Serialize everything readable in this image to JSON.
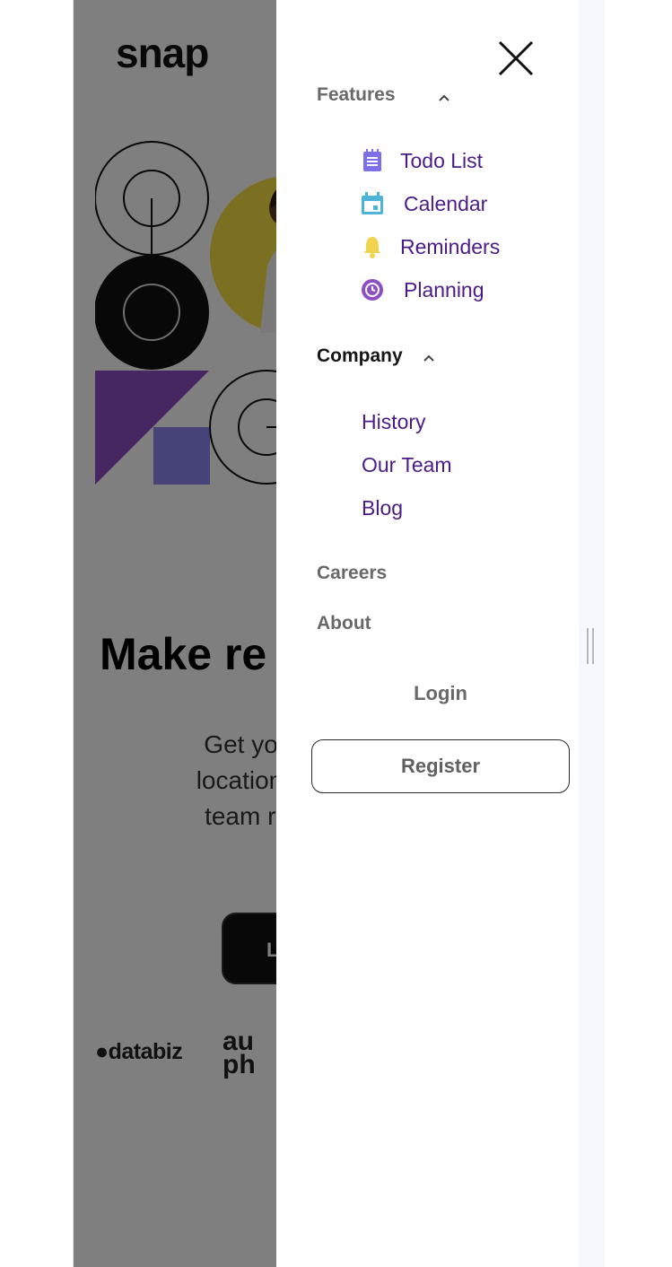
{
  "background_page": {
    "logo": "snap",
    "headline": "Make re",
    "subtext_lines": [
      "Get your team",
      "location. Strean",
      "team rituals, a"
    ],
    "cta_label": "L",
    "clients": [
      "databiz",
      "au",
      "ph"
    ]
  },
  "menu": {
    "sections": [
      {
        "title": "Features",
        "expanded": true,
        "items": [
          {
            "label": "Todo List",
            "icon": "todo-icon",
            "color": "#7c6fe8"
          },
          {
            "label": "Calendar",
            "icon": "calendar-icon",
            "color": "#4eb3d9"
          },
          {
            "label": "Reminders",
            "icon": "bell-icon",
            "color": "#f0d450"
          },
          {
            "label": "Planning",
            "icon": "clock-icon",
            "color": "#8e4fc4"
          }
        ]
      },
      {
        "title": "Company",
        "expanded": true,
        "items": [
          {
            "label": "History"
          },
          {
            "label": "Our Team"
          },
          {
            "label": "Blog"
          }
        ]
      }
    ],
    "links": [
      {
        "label": "Careers"
      },
      {
        "label": "About"
      }
    ],
    "login_label": "Login",
    "register_label": "Register"
  },
  "colors": {
    "submenu_text": "#4b1b87",
    "nav_text": "#696969",
    "overlay": "rgba(0,0,0,0.5)"
  }
}
